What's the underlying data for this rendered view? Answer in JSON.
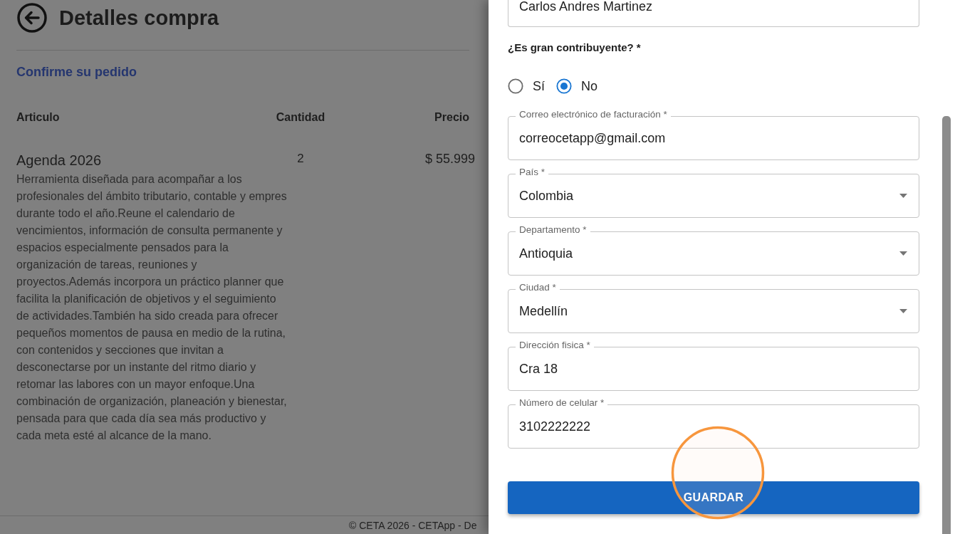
{
  "page": {
    "title": "Detalles compra",
    "subtitle": "Confirme su pedido"
  },
  "order_table": {
    "columns": [
      "Articulo",
      "Cantidad",
      "Precio"
    ],
    "rows": [
      {
        "name": "Agenda 2026",
        "description": "Herramienta diseñada para acompañar a los profesionales del ámbito tributario, contable y empres durante todo el año.Reune el calendario de vencimientos, información de consulta permanente y espacios especialmente pensados para la organización de tareas, reuniones y proyectos.Además incorpora un práctico planner que facilita la planificación de objetivos y el seguimiento de actividades.También ha sido creada para ofrecer pequeños momentos de pausa en medio de la rutina, con contenidos y secciones que invitan a desconectarse por un instante del ritmo diario y retomar las labores con un mayor enfoque.Una combinación de organización, planeación y bienestar, pensada para que cada día sea más productivo y cada meta esté al alcance de la mano.",
        "quantity": "2",
        "price": "$ 55.999"
      }
    ]
  },
  "footer": {
    "text": "© CETA 2026 - CETApp - De"
  },
  "form": {
    "name_field": {
      "value": "Carlos Andres Martinez"
    },
    "question": "¿Es gran contribuyente? *",
    "options": [
      {
        "label": "Sí",
        "selected": false
      },
      {
        "label": "No",
        "selected": true
      }
    ],
    "fields": [
      {
        "kind": "text",
        "label": "Correo electrónico de facturación *",
        "value": "correocetapp@gmail.com"
      },
      {
        "kind": "select",
        "label": "País *",
        "value": "Colombia"
      },
      {
        "kind": "select",
        "label": "Departamento *",
        "value": "Antioquia"
      },
      {
        "kind": "select",
        "label": "Ciudad *",
        "value": "Medellín"
      },
      {
        "kind": "text",
        "label": "Dirección fisica *",
        "value": "Cra 18"
      },
      {
        "kind": "text",
        "label": "Número de celular *",
        "value": "3102222222"
      }
    ],
    "submit": "GUARDAR"
  }
}
